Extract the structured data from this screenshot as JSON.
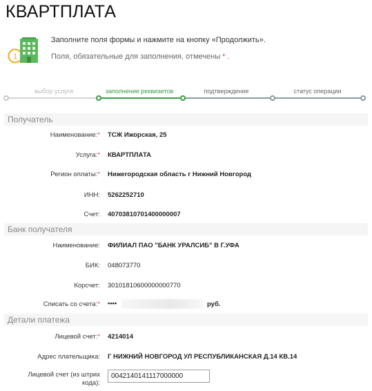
{
  "page": {
    "title": "КВАРТПЛАТА"
  },
  "notice": {
    "line1": "Заполните поля формы и нажмите на кнопку «Продолжить».",
    "line2_text": "Поля, обязательные для заполнения, отмечены",
    "line2_star": "*",
    "line2_end": ".",
    "step_number": "1",
    "icon": "building-icon"
  },
  "stepper": {
    "steps": [
      {
        "label": "выбор услуги",
        "state": "done"
      },
      {
        "label": "заполнение реквизитов",
        "state": "current"
      },
      {
        "label": "подтверждение",
        "state": "pending"
      },
      {
        "label": "статус операции",
        "state": "pending"
      }
    ],
    "colors": {
      "active": "#3a9b45",
      "inactive": "#8a9aa4",
      "done_line": "#d4d4d4"
    }
  },
  "recipient": {
    "title": "Получатель",
    "name_label": "Наименование:",
    "name_value": "ТСЖ Ижорская, 25",
    "service_label": "Услуга:",
    "service_value": "КВАРТПЛАТА",
    "region_label": "Регион оплаты:",
    "region_value": "Нижегородская область г Нижний Новгород",
    "inn_label": "ИНН:",
    "inn_value": "5262252710",
    "account_label": "Счет:",
    "account_value": "40703810701400000007"
  },
  "bank": {
    "title": "Банк получателя",
    "name_label": "Наименование:",
    "name_value": "ФИЛИАЛ ПАО \"БАНК УРАЛСИБ\" В Г.УФА",
    "bik_label": "БИК:",
    "bik_value": "048073770",
    "corr_label": "Корсчет:",
    "corr_value": "30101810600000000770",
    "debit_label": "Списать со счета:",
    "debit_value_prefix": "••••",
    "debit_currency": "руб."
  },
  "details": {
    "title": "Детали платежа",
    "account_label": "Лицевой счет:",
    "account_value": "4214014",
    "address_label": "Адрес плательщика:",
    "address_value": "Г НИЖНИЙ НОВГОРОД УЛ РЕСПУБЛИКАНСКАЯ Д.14 КВ.14",
    "barcode_label_line1": "Лицевой счет (из штрих",
    "barcode_label_line2": "кода):",
    "barcode_value": "0042140141117000000"
  },
  "required_star": "*"
}
